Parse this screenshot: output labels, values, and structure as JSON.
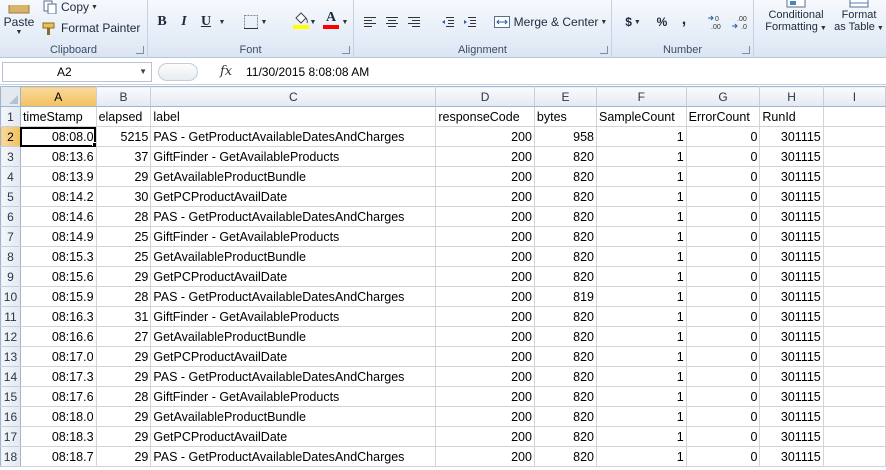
{
  "ribbon": {
    "clipboard": {
      "label": "Clipboard",
      "paste": "Paste",
      "copy": "Copy",
      "format_painter": "Format Painter"
    },
    "font": {
      "label": "Font",
      "bold": "B",
      "italic": "I",
      "underline": "U"
    },
    "alignment": {
      "label": "Alignment",
      "merge_center": "Merge & Center"
    },
    "number": {
      "label": "Number",
      "currency": "$",
      "percent": "%",
      "comma": ","
    },
    "styles": {
      "conditional_formatting": [
        "Conditional",
        "Formatting"
      ],
      "format_as_table": [
        "Format",
        "as Table"
      ]
    },
    "colors": {
      "highlight": "#ffff00",
      "font_color": "#ff0000",
      "accent": "#f1c15f"
    }
  },
  "formula_bar": {
    "name_box": "A2",
    "fx": "fx",
    "value": "11/30/2015  8:08:08 AM"
  },
  "grid": {
    "columns": [
      "A",
      "B",
      "C",
      "D",
      "E",
      "F",
      "G",
      "H",
      "I"
    ],
    "active_column": "A",
    "active_row": "2",
    "header_row": {
      "row": "1",
      "cells": [
        "timeStamp",
        "elapsed",
        "label",
        "responseCode",
        "bytes",
        "SampleCount",
        "ErrorCount",
        "RunId",
        ""
      ]
    },
    "rows": [
      {
        "row": "2",
        "timeStamp": "08:08.0",
        "elapsed": "5215",
        "label": "PAS - GetProductAvailableDatesAndCharges",
        "responseCode": "200",
        "bytes": "958",
        "SampleCount": "1",
        "ErrorCount": "0",
        "RunId": "301115"
      },
      {
        "row": "3",
        "timeStamp": "08:13.6",
        "elapsed": "37",
        "label": "GiftFinder - GetAvailableProducts",
        "responseCode": "200",
        "bytes": "820",
        "SampleCount": "1",
        "ErrorCount": "0",
        "RunId": "301115"
      },
      {
        "row": "4",
        "timeStamp": "08:13.9",
        "elapsed": "29",
        "label": "GetAvailableProductBundle",
        "responseCode": "200",
        "bytes": "820",
        "SampleCount": "1",
        "ErrorCount": "0",
        "RunId": "301115"
      },
      {
        "row": "5",
        "timeStamp": "08:14.2",
        "elapsed": "30",
        "label": "GetPCProductAvailDate",
        "responseCode": "200",
        "bytes": "820",
        "SampleCount": "1",
        "ErrorCount": "0",
        "RunId": "301115"
      },
      {
        "row": "6",
        "timeStamp": "08:14.6",
        "elapsed": "28",
        "label": "PAS - GetProductAvailableDatesAndCharges",
        "responseCode": "200",
        "bytes": "820",
        "SampleCount": "1",
        "ErrorCount": "0",
        "RunId": "301115"
      },
      {
        "row": "7",
        "timeStamp": "08:14.9",
        "elapsed": "25",
        "label": "GiftFinder - GetAvailableProducts",
        "responseCode": "200",
        "bytes": "820",
        "SampleCount": "1",
        "ErrorCount": "0",
        "RunId": "301115"
      },
      {
        "row": "8",
        "timeStamp": "08:15.3",
        "elapsed": "25",
        "label": "GetAvailableProductBundle",
        "responseCode": "200",
        "bytes": "820",
        "SampleCount": "1",
        "ErrorCount": "0",
        "RunId": "301115"
      },
      {
        "row": "9",
        "timeStamp": "08:15.6",
        "elapsed": "29",
        "label": "GetPCProductAvailDate",
        "responseCode": "200",
        "bytes": "820",
        "SampleCount": "1",
        "ErrorCount": "0",
        "RunId": "301115"
      },
      {
        "row": "10",
        "timeStamp": "08:15.9",
        "elapsed": "28",
        "label": "PAS - GetProductAvailableDatesAndCharges",
        "responseCode": "200",
        "bytes": "819",
        "SampleCount": "1",
        "ErrorCount": "0",
        "RunId": "301115"
      },
      {
        "row": "11",
        "timeStamp": "08:16.3",
        "elapsed": "31",
        "label": "GiftFinder - GetAvailableProducts",
        "responseCode": "200",
        "bytes": "820",
        "SampleCount": "1",
        "ErrorCount": "0",
        "RunId": "301115"
      },
      {
        "row": "12",
        "timeStamp": "08:16.6",
        "elapsed": "27",
        "label": "GetAvailableProductBundle",
        "responseCode": "200",
        "bytes": "820",
        "SampleCount": "1",
        "ErrorCount": "0",
        "RunId": "301115"
      },
      {
        "row": "13",
        "timeStamp": "08:17.0",
        "elapsed": "29",
        "label": "GetPCProductAvailDate",
        "responseCode": "200",
        "bytes": "820",
        "SampleCount": "1",
        "ErrorCount": "0",
        "RunId": "301115"
      },
      {
        "row": "14",
        "timeStamp": "08:17.3",
        "elapsed": "29",
        "label": "PAS - GetProductAvailableDatesAndCharges",
        "responseCode": "200",
        "bytes": "820",
        "SampleCount": "1",
        "ErrorCount": "0",
        "RunId": "301115"
      },
      {
        "row": "15",
        "timeStamp": "08:17.6",
        "elapsed": "28",
        "label": "GiftFinder - GetAvailableProducts",
        "responseCode": "200",
        "bytes": "820",
        "SampleCount": "1",
        "ErrorCount": "0",
        "RunId": "301115"
      },
      {
        "row": "16",
        "timeStamp": "08:18.0",
        "elapsed": "29",
        "label": "GetAvailableProductBundle",
        "responseCode": "200",
        "bytes": "820",
        "SampleCount": "1",
        "ErrorCount": "0",
        "RunId": "301115"
      },
      {
        "row": "17",
        "timeStamp": "08:18.3",
        "elapsed": "29",
        "label": "GetPCProductAvailDate",
        "responseCode": "200",
        "bytes": "820",
        "SampleCount": "1",
        "ErrorCount": "0",
        "RunId": "301115"
      },
      {
        "row": "18",
        "timeStamp": "08:18.7",
        "elapsed": "29",
        "label": "PAS - GetProductAvailableDatesAndCharges",
        "responseCode": "200",
        "bytes": "820",
        "SampleCount": "1",
        "ErrorCount": "0",
        "RunId": "301115"
      }
    ]
  }
}
